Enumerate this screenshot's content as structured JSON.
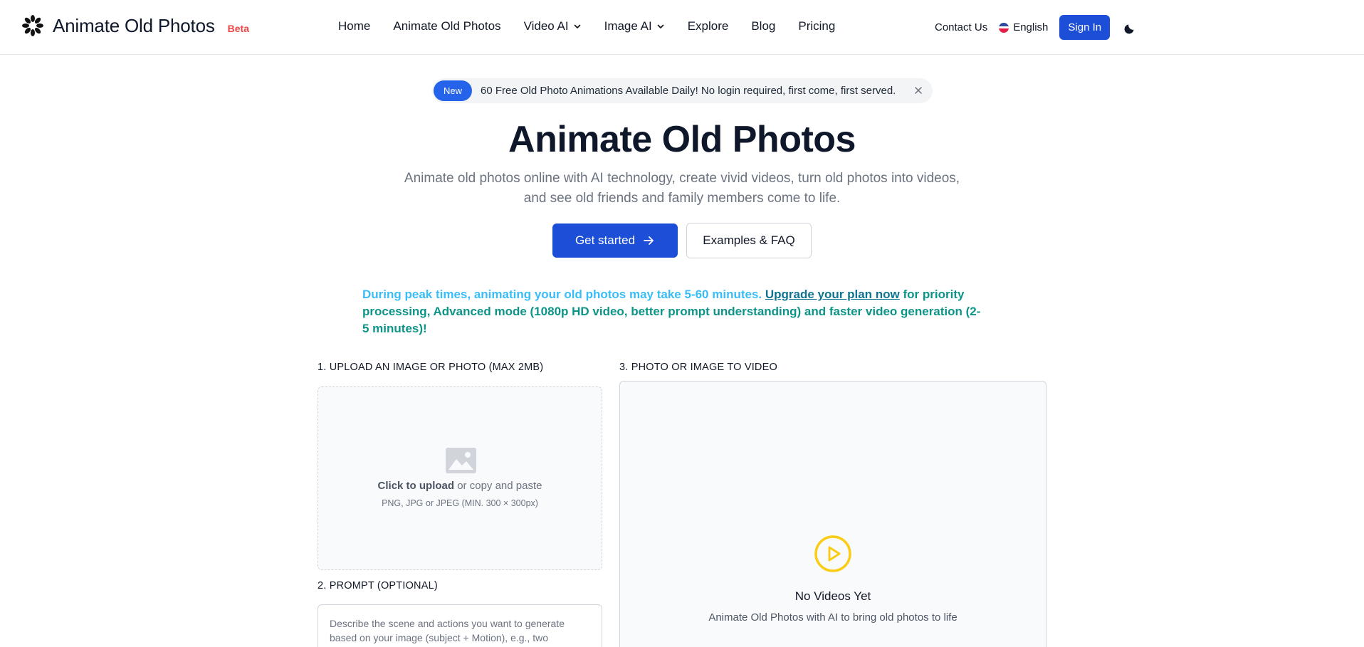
{
  "header": {
    "logo_text": "Animate Old Photos",
    "beta_label": "Beta",
    "nav": [
      {
        "label": "Home"
      },
      {
        "label": "Animate Old Photos"
      },
      {
        "label": "Video AI",
        "dropdown": true
      },
      {
        "label": "Image AI",
        "dropdown": true
      },
      {
        "label": "Explore"
      },
      {
        "label": "Blog"
      },
      {
        "label": "Pricing"
      }
    ],
    "contact_label": "Contact Us",
    "language_label": "English",
    "sign_in_label": "Sign In",
    "icons": {
      "logo": "sparkle-logo-icon",
      "theme": "moon-icon",
      "flag": "us-flag-icon"
    }
  },
  "banner": {
    "badge": "New",
    "text": "60 Free Old Photo Animations Available Daily! No login required, first come, first served."
  },
  "hero": {
    "title": "Animate Old Photos",
    "subtitle": "Animate old photos online with AI technology, create vivid videos, turn old photos into videos, and see old friends and family members come to life.",
    "primary_button": "Get started",
    "secondary_button": "Examples & FAQ"
  },
  "notice": {
    "part1": "During peak times, animating your old photos may take 5-60 minutes.",
    "link": "Upgrade your plan now",
    "part2": "for priority processing, Advanced mode (1080p HD video, better prompt understanding) and faster video generation (2-5 minutes)!"
  },
  "upload": {
    "section_label": "1. UPLOAD AN IMAGE OR PHOTO (MAX 2MB)",
    "click_text": "Click to upload",
    "rest_text": "or copy and paste",
    "formats": "PNG, JPG or JPEG (MIN. 300 × 300px)"
  },
  "prompt": {
    "section_label": "2. PROMPT (OPTIONAL)",
    "placeholder": "Describe the scene and actions you want to generate based on your image (subject + Motion), e.g., two"
  },
  "video": {
    "section_label": "3. PHOTO OR IMAGE TO VIDEO",
    "empty_title": "No Videos Yet",
    "empty_subtitle": "Animate Old Photos with AI to bring old photos to life"
  },
  "colors": {
    "primary": "#1d4ed8",
    "notice_blue": "#38bdf8",
    "notice_teal": "#0d9488",
    "beta_red": "#ef4444",
    "play_yellow": "#facc15"
  }
}
